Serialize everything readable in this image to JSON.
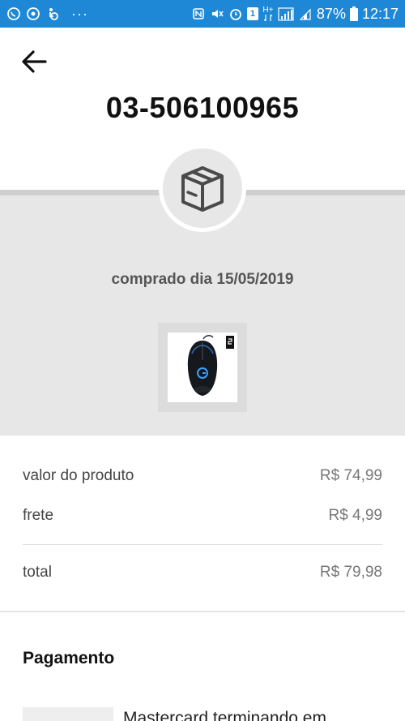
{
  "status_bar": {
    "battery_percent": "87%",
    "time": "12:17",
    "notification_dots": "···",
    "network_label_top": "H+",
    "sim_label": "1",
    "background_color": "#1e88d6",
    "icons_left": [
      "whatsapp-icon",
      "sync-icon",
      "accessibility-icon"
    ],
    "icons_right": [
      "nfc-icon",
      "mute-icon",
      "alarm-icon",
      "sim-icon",
      "network-icon",
      "signal-icon",
      "battery-icon"
    ]
  },
  "header": {
    "order_number": "03-506100965",
    "back_icon": "arrow-left-icon"
  },
  "order": {
    "purchase_date": "comprado dia 15/05/2019",
    "status_icon": "package-box-icon",
    "product_image": "gaming-mouse"
  },
  "summary": {
    "product_value_label": "valor do produto",
    "product_value": "R$ 74,99",
    "shipping_label": "frete",
    "shipping_value": "R$ 4,99",
    "total_label": "total",
    "total_value": "R$ 79,98"
  },
  "payment": {
    "title": "Pagamento",
    "card_description": "Mastercard terminando em"
  }
}
